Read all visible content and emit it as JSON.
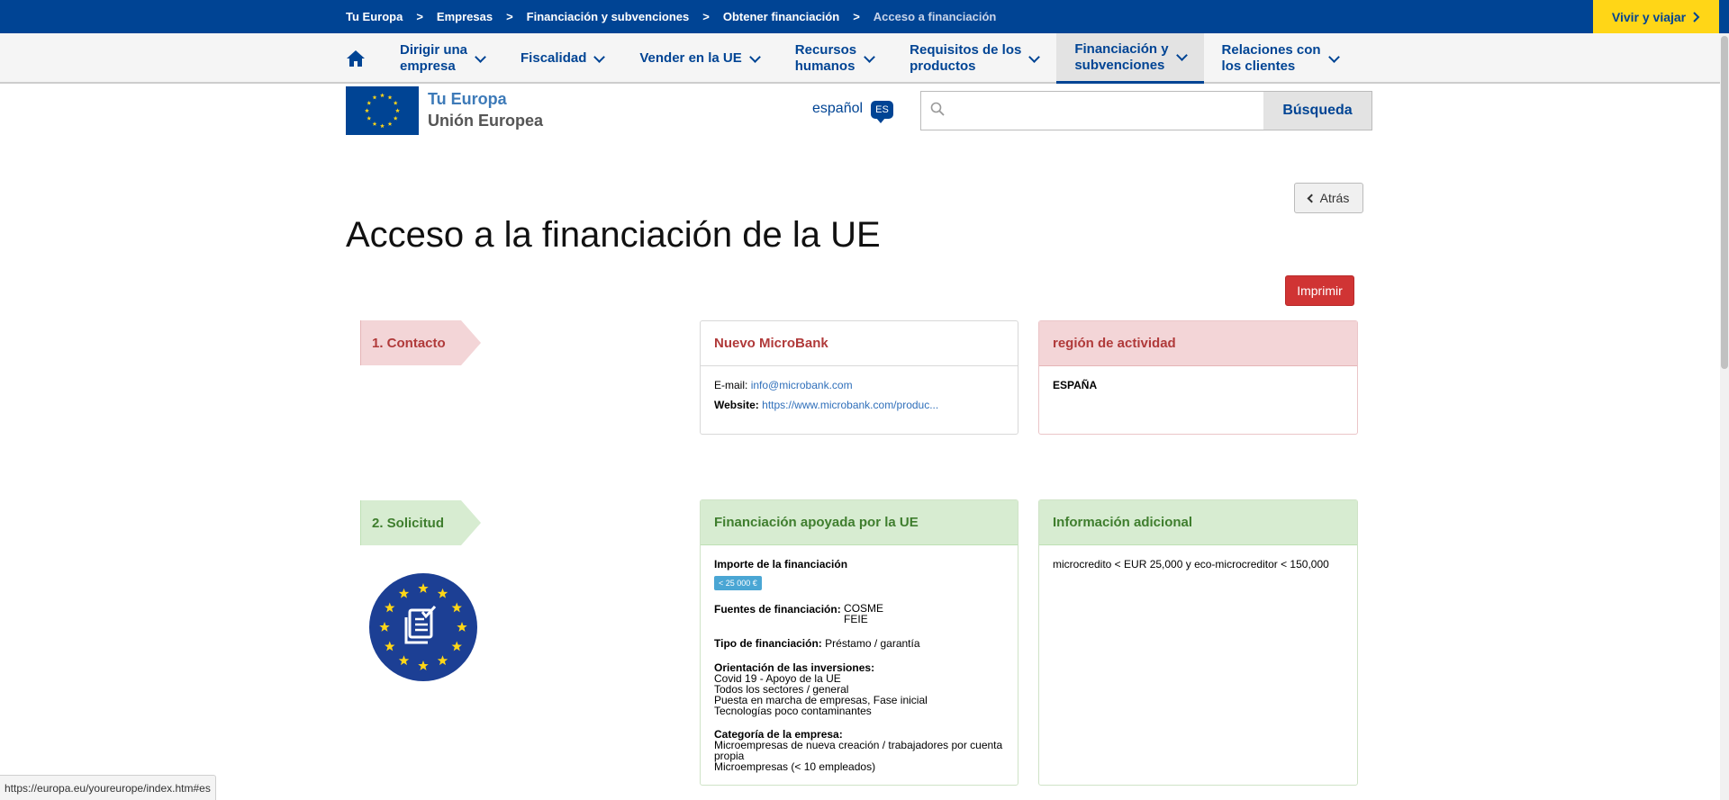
{
  "breadcrumb": [
    "Tu Europa",
    "Empresas",
    "Financiación y subvenciones",
    "Obtener financiación",
    "Acceso a financiación"
  ],
  "breadcrumb_sep": ">",
  "vivir_label": "Vivir y viajar",
  "nav": {
    "items": [
      {
        "label": "Dirigir una empresa",
        "l1": "Dirigir una",
        "l2": "empresa"
      },
      {
        "label": "Fiscalidad",
        "l1": "Fiscalidad",
        "l2": ""
      },
      {
        "label": "Vender en la UE",
        "l1": "Vender en la UE",
        "l2": ""
      },
      {
        "label": "Recursos humanos",
        "l1": "Recursos",
        "l2": "humanos"
      },
      {
        "label": "Requisitos de los productos",
        "l1": "Requisitos de los",
        "l2": "productos"
      },
      {
        "label": "Financiación y subvenciones",
        "l1": "Financiación y",
        "l2": "subvenciones"
      },
      {
        "label": "Relaciones con los clientes",
        "l1": "Relaciones con",
        "l2": "los clientes"
      }
    ]
  },
  "header": {
    "logo_line1": "Tu Europa",
    "logo_line2": "Unión Europea",
    "language": "español",
    "language_code": "ES",
    "search_placeholder": "",
    "search_button": "Búsqueda"
  },
  "page": {
    "back_label": "Atrás",
    "title": "Acceso a la financiación de la UE",
    "print_label": "Imprimir"
  },
  "steps": {
    "contact": "1. Contacto",
    "application": "2. Solicitud"
  },
  "microbank": {
    "title": "Nuevo MicroBank",
    "email_label": "E-mail:",
    "email": "info@microbank.com",
    "website_label": "Website:",
    "website": "https://www.microbank.com/produc..."
  },
  "region": {
    "title": "región de actividad",
    "value": "ESPAÑA"
  },
  "funding": {
    "title": "Financiación apoyada por la UE",
    "amount_label": "Importe de la financiación",
    "amount_badge": "< 25 000 €",
    "sources_label": "Fuentes de financiación:",
    "sources": [
      "COSME",
      "FEIE"
    ],
    "type_label": "Tipo de financiación:",
    "type_value": "Préstamo / garantía",
    "orientation_label": "Orientación de las inversiones:",
    "orientation": [
      "Covid 19 - Apoyo de la UE",
      "Todos los sectores / general",
      "Puesta en marcha de empresas, Fase inicial",
      "Tecnologías poco contaminantes"
    ],
    "category_label": "Categoría de la empresa:",
    "category": [
      "Microempresas de nueva creación / trabajadores por cuenta",
      "propia",
      "Microempresas (< 10 empleados)"
    ]
  },
  "additional": {
    "title": "Información adicional",
    "text": "microcredito < EUR 25,000 y eco-microcreditor < 150,000"
  },
  "status_url": "https://europa.eu/youreurope/index.htm#es",
  "colors": {
    "eu_blue": "#004494",
    "eu_yellow": "#ffd617",
    "red": "#d03434",
    "green_header": "#d7ecd1",
    "pink_header": "#f3d5d7"
  }
}
